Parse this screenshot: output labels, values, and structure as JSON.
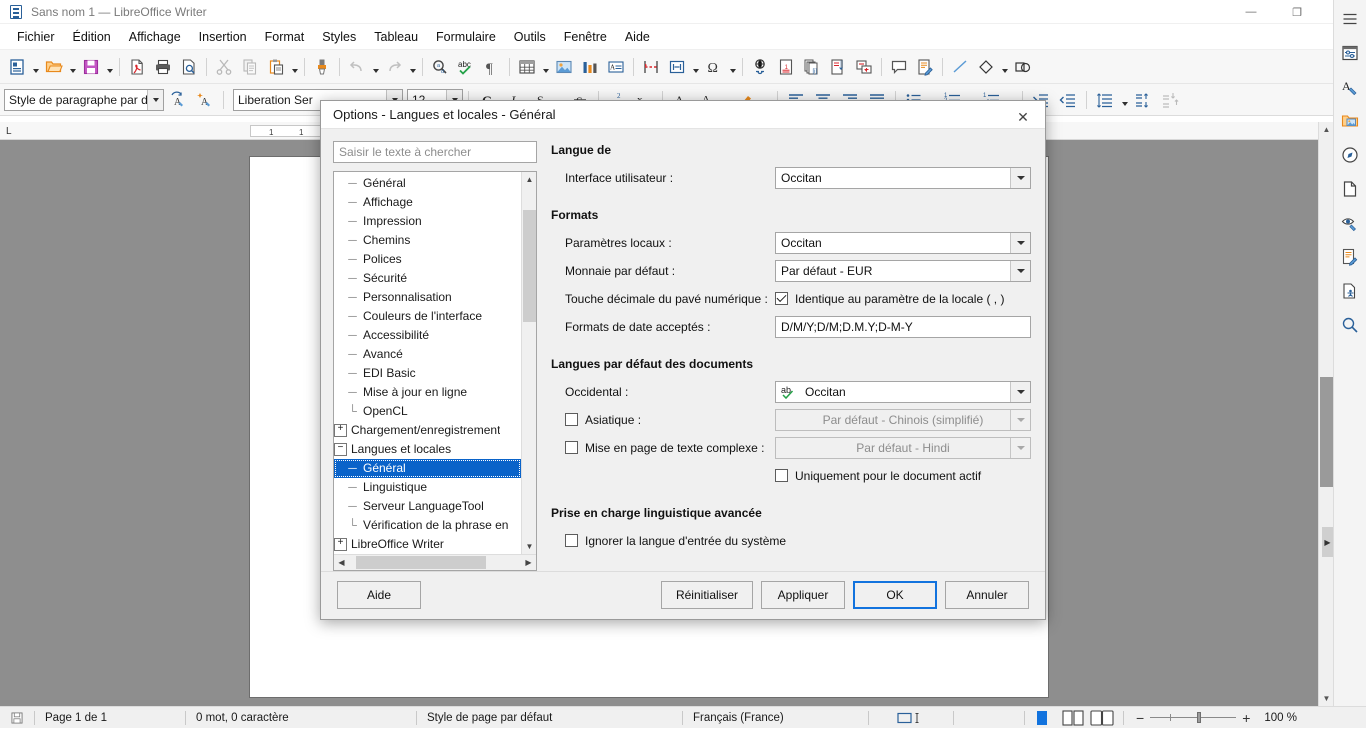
{
  "titlebar": {
    "title": "Sans nom 1 — LibreOffice Writer",
    "minimize": "—",
    "restore": "❐",
    "close": "✕"
  },
  "menubar": {
    "items": [
      "Fichier",
      "Édition",
      "Affichage",
      "Insertion",
      "Format",
      "Styles",
      "Tableau",
      "Formulaire",
      "Outils",
      "Fenêtre",
      "Aide"
    ]
  },
  "toolbar": {
    "icons": [
      "new-document-icon",
      "open-file-icon",
      "save-icon",
      "export-pdf-icon",
      "print-icon",
      "print-preview-icon",
      "cut-icon",
      "copy-icon",
      "paste-icon",
      "clone-formatting-icon",
      "undo-icon",
      "redo-icon",
      "find-replace-icon",
      "spelling-icon",
      "formatting-marks-icon",
      "insert-table-icon",
      "insert-image-icon",
      "insert-chart-icon",
      "insert-text-box-icon",
      "page-break-icon",
      "insert-field-icon",
      "special-character-icon",
      "insert-hyperlink-icon",
      "footnote-icon",
      "endnote-icon",
      "bookmark-icon",
      "cross-reference-icon",
      "comment-icon",
      "track-changes-icon",
      "line-icon",
      "basic-shapes-icon",
      "show-draw-functions-icon"
    ]
  },
  "formatbar": {
    "paragraph_style": "Style de paragraphe par défa",
    "font_name": "Liberation Ser",
    "font_size": "12",
    "icons": [
      "update-style-icon",
      "new-style-icon",
      "bold-icon",
      "italic-icon",
      "underline-icon",
      "strikethrough-icon",
      "superscript-icon",
      "subscript-icon",
      "clear-formatting-icon",
      "font-color-icon",
      "highlight-icon",
      "align-left-icon",
      "align-center-icon",
      "align-right-icon",
      "justify-icon",
      "unordered-list-icon",
      "ordered-list-icon",
      "outline-list-icon",
      "increase-indent-icon",
      "decrease-indent-icon",
      "line-spacing-icon",
      "paragraph-spacing-icon",
      "set-paragraph-spacing-icon"
    ]
  },
  "ruler": {
    "corner_label": "L",
    "ticks": [
      "1",
      "1"
    ]
  },
  "sidebar": {
    "items": [
      "sidebar-settings-icon",
      "properties-icon",
      "styles-icon",
      "gallery-icon",
      "navigator-icon",
      "page-icon",
      "style-inspector-icon",
      "manage-changes-icon",
      "accessibility-check-icon",
      "find-icon"
    ]
  },
  "statusbar": {
    "save_icon": "save-status-icon",
    "page": "Page 1 de 1",
    "words": "0 mot, 0 caractère",
    "page_style": "Style de page par défaut",
    "language": "Français (France)",
    "selection_mode": "selection-mode-icon",
    "view_single": "single-page-view-icon",
    "view_multi": "multi-page-view-icon",
    "view_book": "book-view-icon",
    "zoom_out": "−",
    "zoom_in": "+",
    "zoom_level": "100 %"
  },
  "dialog": {
    "title": "Options - Langues et locales - Général",
    "close_icon": "close-icon",
    "search": {
      "placeholder": "Saisir le texte à chercher",
      "value": ""
    },
    "tree": [
      {
        "label": "Général",
        "level": 1,
        "marker": "dash"
      },
      {
        "label": "Affichage",
        "level": 1,
        "marker": "dash"
      },
      {
        "label": "Impression",
        "level": 1,
        "marker": "dash"
      },
      {
        "label": "Chemins",
        "level": 1,
        "marker": "dash"
      },
      {
        "label": "Polices",
        "level": 1,
        "marker": "dash"
      },
      {
        "label": "Sécurité",
        "level": 1,
        "marker": "dash"
      },
      {
        "label": "Personnalisation",
        "level": 1,
        "marker": "dash"
      },
      {
        "label": "Couleurs de l'interface",
        "level": 1,
        "marker": "dash"
      },
      {
        "label": "Accessibilité",
        "level": 1,
        "marker": "dash"
      },
      {
        "label": "Avancé",
        "level": 1,
        "marker": "dash"
      },
      {
        "label": "EDI Basic",
        "level": 1,
        "marker": "dash"
      },
      {
        "label": "Mise à jour en ligne",
        "level": 1,
        "marker": "dash"
      },
      {
        "label": "OpenCL",
        "level": 1,
        "marker": "dash-end"
      },
      {
        "label": "Chargement/enregistrement",
        "level": 0,
        "marker": "plus"
      },
      {
        "label": "Langues et locales",
        "level": 0,
        "marker": "minus"
      },
      {
        "label": "Général",
        "level": 1,
        "marker": "dash",
        "selected": true
      },
      {
        "label": "Linguistique",
        "level": 1,
        "marker": "dash"
      },
      {
        "label": "Serveur LanguageTool",
        "level": 1,
        "marker": "dash"
      },
      {
        "label": "Vérification de la phrase en",
        "level": 1,
        "marker": "dash-end"
      },
      {
        "label": "LibreOffice Writer",
        "level": 0,
        "marker": "plus"
      }
    ],
    "sections": {
      "language_of": {
        "title": "Langue de",
        "ui_label": "Interface utilisateur :",
        "ui_value": "Occitan"
      },
      "formats": {
        "title": "Formats",
        "locale_label": "Paramètres locaux :",
        "locale_value": "Occitan",
        "currency_label": "Monnaie par défaut :",
        "currency_value": "Par défaut - EUR",
        "decimal_label": "Touche décimale du pavé numérique :",
        "decimal_checkbox": "Identique au paramètre de la locale ( , )",
        "decimal_checked": true,
        "date_label": "Formats de date acceptés :",
        "date_value": "D/M/Y;D/M;D.M.Y;D-M-Y"
      },
      "default_doc_languages": {
        "title": "Langues par défaut des documents",
        "western_label": "Occidental :",
        "western_value": "Occitan",
        "western_icon": "spellcheck-ab-icon",
        "asian_label": "Asiatique :",
        "asian_checked": false,
        "asian_value": "Par défaut - Chinois (simplifié)",
        "ctl_label": "Mise en page de texte complexe :",
        "ctl_checked": false,
        "ctl_value": "Par défaut - Hindi",
        "current_doc_label": "Uniquement pour le document actif",
        "current_doc_checked": false
      },
      "enhanced_language": {
        "title": "Prise en charge linguistique avancée",
        "ignore_label": "Ignorer la langue d'entrée du système",
        "ignore_checked": false
      }
    },
    "buttons": {
      "help": "Aide",
      "reset": "Réinitialiser",
      "apply": "Appliquer",
      "ok": "OK",
      "cancel": "Annuler"
    }
  },
  "colors": {
    "accent": "#1273de",
    "selection": "#0a63c9",
    "dialog_bg": "#f0f0f0",
    "toolbar_bg": "#f7f7f7",
    "workspace_bg": "#8e8e8e"
  }
}
